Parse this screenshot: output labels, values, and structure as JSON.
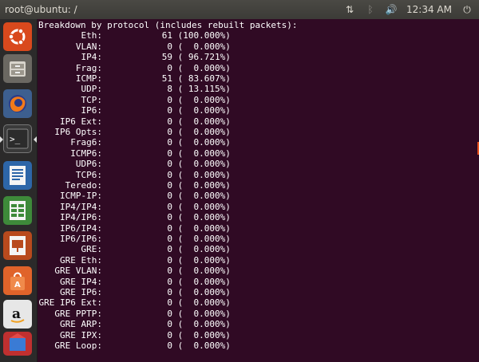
{
  "window": {
    "title": "root@ubuntu: /"
  },
  "tray": {
    "clock": "12:34 AM",
    "power_symbol": "⏻",
    "network_symbol": "⇅",
    "bluetooth_symbol": "ᛒ",
    "volume_symbol": "🔊"
  },
  "launcher": {
    "items": [
      {
        "name": "ubuntu-dash",
        "active": false
      },
      {
        "name": "files",
        "active": false
      },
      {
        "name": "firefox",
        "active": false
      },
      {
        "name": "terminal",
        "active": true
      },
      {
        "name": "writer",
        "active": false
      },
      {
        "name": "calc",
        "active": false
      },
      {
        "name": "impress",
        "active": false
      },
      {
        "name": "software-center",
        "active": false
      },
      {
        "name": "amazon",
        "active": false
      },
      {
        "name": "more",
        "active": false
      }
    ],
    "terminal_prompt_glyph": ">_",
    "amazon_glyph": "a"
  },
  "terminal": {
    "heading": "Breakdown by protocol (includes rebuilt packets):",
    "rows": [
      {
        "proto": "Eth:",
        "count": "61",
        "pct": "(100.000%)"
      },
      {
        "proto": "VLAN:",
        "count": "0",
        "pct": "(  0.000%)"
      },
      {
        "proto": "IP4:",
        "count": "59",
        "pct": "( 96.721%)"
      },
      {
        "proto": "Frag:",
        "count": "0",
        "pct": "(  0.000%)"
      },
      {
        "proto": "ICMP:",
        "count": "51",
        "pct": "( 83.607%)"
      },
      {
        "proto": "UDP:",
        "count": "8",
        "pct": "( 13.115%)"
      },
      {
        "proto": "TCP:",
        "count": "0",
        "pct": "(  0.000%)"
      },
      {
        "proto": "IP6:",
        "count": "0",
        "pct": "(  0.000%)"
      },
      {
        "proto": "IP6 Ext:",
        "count": "0",
        "pct": "(  0.000%)"
      },
      {
        "proto": "IP6 Opts:",
        "count": "0",
        "pct": "(  0.000%)"
      },
      {
        "proto": "Frag6:",
        "count": "0",
        "pct": "(  0.000%)"
      },
      {
        "proto": "ICMP6:",
        "count": "0",
        "pct": "(  0.000%)"
      },
      {
        "proto": "UDP6:",
        "count": "0",
        "pct": "(  0.000%)"
      },
      {
        "proto": "TCP6:",
        "count": "0",
        "pct": "(  0.000%)"
      },
      {
        "proto": "Teredo:",
        "count": "0",
        "pct": "(  0.000%)"
      },
      {
        "proto": "ICMP-IP:",
        "count": "0",
        "pct": "(  0.000%)"
      },
      {
        "proto": "IP4/IP4:",
        "count": "0",
        "pct": "(  0.000%)"
      },
      {
        "proto": "IP4/IP6:",
        "count": "0",
        "pct": "(  0.000%)"
      },
      {
        "proto": "IP6/IP4:",
        "count": "0",
        "pct": "(  0.000%)"
      },
      {
        "proto": "IP6/IP6:",
        "count": "0",
        "pct": "(  0.000%)"
      },
      {
        "proto": "GRE:",
        "count": "0",
        "pct": "(  0.000%)"
      },
      {
        "proto": "GRE Eth:",
        "count": "0",
        "pct": "(  0.000%)"
      },
      {
        "proto": "GRE VLAN:",
        "count": "0",
        "pct": "(  0.000%)"
      },
      {
        "proto": "GRE IP4:",
        "count": "0",
        "pct": "(  0.000%)"
      },
      {
        "proto": "GRE IP6:",
        "count": "0",
        "pct": "(  0.000%)"
      },
      {
        "proto": "GRE IP6 Ext:",
        "count": "0",
        "pct": "(  0.000%)"
      },
      {
        "proto": "GRE PPTP:",
        "count": "0",
        "pct": "(  0.000%)"
      },
      {
        "proto": "GRE ARP:",
        "count": "0",
        "pct": "(  0.000%)"
      },
      {
        "proto": "GRE IPX:",
        "count": "0",
        "pct": "(  0.000%)"
      },
      {
        "proto": "GRE Loop:",
        "count": "0",
        "pct": "(  0.000%)"
      }
    ]
  },
  "colors": {
    "terminal_bg": "#300a24",
    "panel_bg": "#3c3b37",
    "launcher_bg": "#2b2a2a",
    "accent": "#e95420"
  }
}
